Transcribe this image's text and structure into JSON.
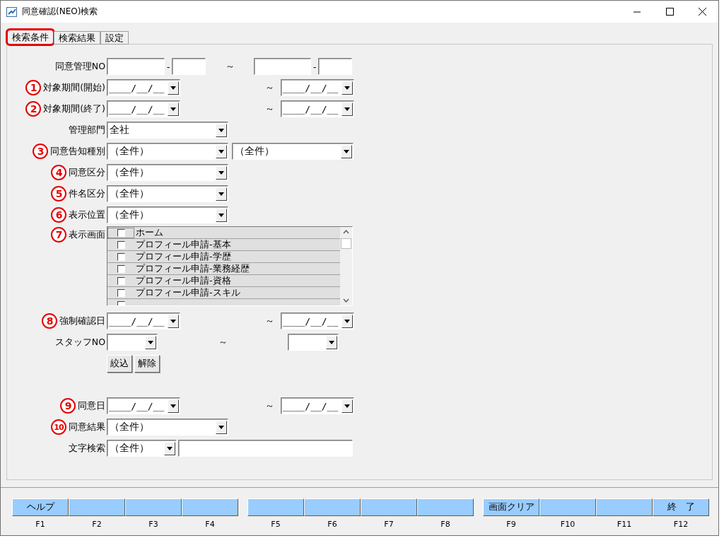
{
  "window": {
    "title": "同意確認(NEO)検索"
  },
  "tabs": [
    {
      "label": "検索条件",
      "selected": true,
      "highlighted": true
    },
    {
      "label": "検索結果",
      "selected": false,
      "highlighted": false
    },
    {
      "label": "設定",
      "selected": false,
      "highlighted": false
    }
  ],
  "form": {
    "rows": [
      {
        "kind": "number_range",
        "label": "同意管理NO",
        "separators": [
          "-",
          "-"
        ],
        "tilde": "～"
      },
      {
        "kind": "date_range",
        "marker": "1",
        "label": "対象期間(開始)",
        "from": "____/__/__",
        "tilde": "～",
        "to": "____/__/__"
      },
      {
        "kind": "date_range",
        "marker": "2",
        "label": "対象期間(終了)",
        "from": "____/__/__",
        "tilde": "～",
        "to": "____/__/__"
      },
      {
        "kind": "select",
        "label": "管理部門",
        "value": "全社"
      },
      {
        "kind": "select_pair",
        "marker": "3",
        "label": "同意告知種別",
        "values": [
          "（全件）",
          "（全件）"
        ]
      },
      {
        "kind": "select",
        "marker": "4",
        "label": "同意区分",
        "value": "（全件）"
      },
      {
        "kind": "select",
        "marker": "5",
        "label": "件名区分",
        "value": "（全件）"
      },
      {
        "kind": "select",
        "marker": "6",
        "label": "表示位置",
        "value": "（全件）"
      },
      {
        "kind": "checklist",
        "marker": "7",
        "label": "表示画面",
        "items": [
          {
            "label": "ホーム",
            "checked": false,
            "focused": true
          },
          {
            "label": "プロフィール申請-基本",
            "checked": false,
            "focused": false
          },
          {
            "label": "プロフィール申請-学歴",
            "checked": false,
            "focused": false
          },
          {
            "label": "プロフィール申請-業務経歴",
            "checked": false,
            "focused": false
          },
          {
            "label": "プロフィール申請-資格",
            "checked": false,
            "focused": false
          },
          {
            "label": "プロフィール申請-スキル",
            "checked": false,
            "focused": false
          },
          {
            "checked": false,
            "focused": false
          }
        ]
      },
      {
        "kind": "date_range",
        "marker": "8",
        "label": "強制確認日",
        "from": "____/__/__",
        "tilde": "～",
        "to": "____/__/__"
      },
      {
        "kind": "staff_range",
        "label": "スタッフNO",
        "tilde": "～"
      },
      {
        "kind": "buttons",
        "buttons": [
          "絞込",
          "解除"
        ]
      },
      {
        "kind": "date_range",
        "marker": "9",
        "label": "同意日",
        "from": "____/__/__",
        "tilde": "～",
        "to": "____/__/__"
      },
      {
        "kind": "select",
        "marker": "10",
        "label": "同意結果",
        "value": "（全件）"
      },
      {
        "kind": "text_search",
        "label": "文字検索",
        "value": "（全件）"
      }
    ]
  },
  "function_keys": [
    {
      "label": "ヘルプ",
      "key": "F1"
    },
    {
      "key": "F2"
    },
    {
      "key": "F3"
    },
    {
      "key": "F4"
    },
    {
      "key": "F5"
    },
    {
      "key": "F6"
    },
    {
      "key": "F7"
    },
    {
      "key": "F8"
    },
    {
      "label": "画面クリア",
      "key": "F9"
    },
    {
      "key": "F10"
    },
    {
      "key": "F11"
    },
    {
      "label": "終　了",
      "key": "F12"
    }
  ]
}
